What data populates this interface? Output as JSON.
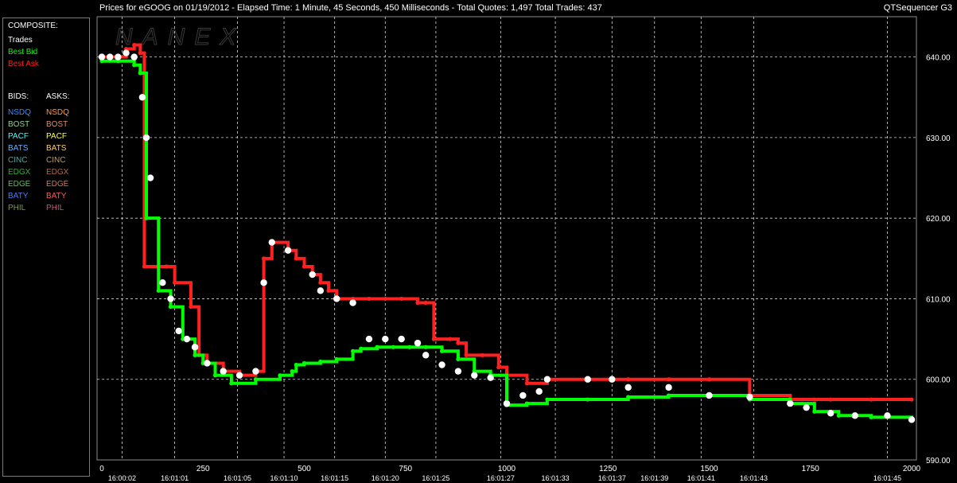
{
  "header": {
    "title": "Prices for  eGOOG  on  01/19/2012  -  Elapsed Time: 1 Minute, 45 Seconds, 450 Milliseconds  -  Total Quotes: 1,497  Total Trades: 437",
    "app": "QTSequencer G3",
    "watermark": "NANEX"
  },
  "legend": {
    "composite_label": "COMPOSITE:",
    "composite": [
      {
        "label": "Trades",
        "color": "#ffffff"
      },
      {
        "label": "Best Bid",
        "color": "#00ff00"
      },
      {
        "label": "Best Ask",
        "color": "#ff2020"
      }
    ],
    "bids_label": "BIDS:",
    "asks_label": "ASKS:",
    "exchanges": [
      {
        "bid": "NSDQ",
        "ask": "NSDQ",
        "bid_color": "#3a8cff",
        "ask_color": "#ff9a3c"
      },
      {
        "bid": "BOST",
        "ask": "BOST",
        "bid_color": "#8fd08f",
        "ask_color": "#e08a6a"
      },
      {
        "bid": "PACF",
        "ask": "PACF",
        "bid_color": "#40ffff",
        "ask_color": "#ffff40"
      },
      {
        "bid": "BATS",
        "ask": "BATS",
        "bid_color": "#6ab4ff",
        "ask_color": "#ffd070"
      },
      {
        "bid": "CINC",
        "ask": "CINC",
        "bid_color": "#4fa8a8",
        "ask_color": "#c09a6a"
      },
      {
        "bid": "EDGX",
        "ask": "EDGX",
        "bid_color": "#3aa83a",
        "ask_color": "#b06a4a"
      },
      {
        "bid": "EDGE",
        "ask": "EDGE",
        "bid_color": "#5fbf5f",
        "ask_color": "#d07a5a"
      },
      {
        "bid": "BATY",
        "ask": "BATY",
        "bid_color": "#4a7aff",
        "ask_color": "#ff5a5a"
      },
      {
        "bid": "PHIL",
        "ask": "PHIL",
        "bid_color": "#7a9a4a",
        "ask_color": "#c05a7a"
      }
    ]
  },
  "chart_data": {
    "type": "line",
    "xlim": [
      0,
      2000
    ],
    "ylim": [
      590,
      645
    ],
    "x_ticks": [
      0,
      250,
      500,
      750,
      1000,
      1250,
      1500,
      1750,
      2000
    ],
    "y_ticks": [
      590,
      600,
      610,
      620,
      630,
      640
    ],
    "time_labels": [
      {
        "x": 50,
        "label": "16:00:02"
      },
      {
        "x": 180,
        "label": "16:01:01"
      },
      {
        "x": 335,
        "label": "16:01:05"
      },
      {
        "x": 450,
        "label": "16:01:10"
      },
      {
        "x": 575,
        "label": "16:01:15"
      },
      {
        "x": 700,
        "label": "16:01:20"
      },
      {
        "x": 825,
        "label": "16:01:25"
      },
      {
        "x": 985,
        "label": "16:01:27"
      },
      {
        "x": 1120,
        "label": "16:01:33"
      },
      {
        "x": 1260,
        "label": "16:01:37"
      },
      {
        "x": 1365,
        "label": "16:01:39"
      },
      {
        "x": 1480,
        "label": "16:01:41"
      },
      {
        "x": 1610,
        "label": "16:01:43"
      },
      {
        "x": 1940,
        "label": "16:01:45"
      }
    ],
    "grid": true,
    "series": [
      {
        "name": "Best Ask",
        "color": "#ff2020",
        "points": [
          [
            0,
            640
          ],
          [
            40,
            640
          ],
          [
            60,
            641
          ],
          [
            80,
            641.5
          ],
          [
            95,
            640.5
          ],
          [
            105,
            614
          ],
          [
            160,
            614
          ],
          [
            180,
            612
          ],
          [
            220,
            609
          ],
          [
            240,
            603
          ],
          [
            260,
            602
          ],
          [
            300,
            601
          ],
          [
            340,
            600.5
          ],
          [
            380,
            601
          ],
          [
            400,
            615
          ],
          [
            420,
            617
          ],
          [
            460,
            616
          ],
          [
            480,
            615
          ],
          [
            500,
            614
          ],
          [
            520,
            613
          ],
          [
            540,
            612
          ],
          [
            560,
            611
          ],
          [
            580,
            610
          ],
          [
            620,
            610
          ],
          [
            660,
            610
          ],
          [
            700,
            610
          ],
          [
            740,
            610
          ],
          [
            780,
            609.5
          ],
          [
            800,
            609.5
          ],
          [
            820,
            605
          ],
          [
            860,
            605
          ],
          [
            880,
            604.5
          ],
          [
            900,
            603
          ],
          [
            940,
            603
          ],
          [
            980,
            601.5
          ],
          [
            1000,
            600.5
          ],
          [
            1050,
            599.5
          ],
          [
            1100,
            600
          ],
          [
            1200,
            600
          ],
          [
            1300,
            600
          ],
          [
            1400,
            600
          ],
          [
            1500,
            600
          ],
          [
            1600,
            598
          ],
          [
            1700,
            597.5
          ],
          [
            1760,
            597.5
          ],
          [
            1800,
            597.5
          ],
          [
            1900,
            597.5
          ],
          [
            2000,
            597.5
          ]
        ]
      },
      {
        "name": "Best Bid",
        "color": "#00ff00",
        "points": [
          [
            0,
            639.5
          ],
          [
            40,
            639.5
          ],
          [
            80,
            639
          ],
          [
            95,
            638
          ],
          [
            110,
            620
          ],
          [
            140,
            611
          ],
          [
            170,
            609
          ],
          [
            200,
            605
          ],
          [
            230,
            603
          ],
          [
            250,
            602
          ],
          [
            280,
            600.5
          ],
          [
            320,
            599.5
          ],
          [
            380,
            600
          ],
          [
            440,
            600.5
          ],
          [
            470,
            601
          ],
          [
            480,
            601.8
          ],
          [
            500,
            602
          ],
          [
            540,
            602.2
          ],
          [
            580,
            602.5
          ],
          [
            620,
            603.5
          ],
          [
            640,
            603.8
          ],
          [
            680,
            604
          ],
          [
            720,
            604
          ],
          [
            760,
            604
          ],
          [
            800,
            604
          ],
          [
            840,
            603.5
          ],
          [
            880,
            602.5
          ],
          [
            920,
            601
          ],
          [
            960,
            600.5
          ],
          [
            1000,
            596.8
          ],
          [
            1050,
            597
          ],
          [
            1100,
            597.5
          ],
          [
            1200,
            597.5
          ],
          [
            1300,
            597.8
          ],
          [
            1400,
            598
          ],
          [
            1500,
            598
          ],
          [
            1600,
            597.5
          ],
          [
            1700,
            597
          ],
          [
            1760,
            596
          ],
          [
            1820,
            595.5
          ],
          [
            1900,
            595.3
          ],
          [
            2000,
            595.2
          ]
        ]
      },
      {
        "name": "Trades",
        "color": "#ffffff",
        "points": [
          [
            0,
            640
          ],
          [
            20,
            640
          ],
          [
            40,
            640
          ],
          [
            60,
            640.5
          ],
          [
            80,
            640
          ],
          [
            100,
            635
          ],
          [
            110,
            630
          ],
          [
            120,
            625
          ],
          [
            150,
            612
          ],
          [
            170,
            610
          ],
          [
            190,
            606
          ],
          [
            210,
            605
          ],
          [
            230,
            604
          ],
          [
            260,
            602
          ],
          [
            300,
            601
          ],
          [
            340,
            600.5
          ],
          [
            380,
            601
          ],
          [
            400,
            612
          ],
          [
            420,
            617
          ],
          [
            460,
            616
          ],
          [
            520,
            613
          ],
          [
            540,
            611
          ],
          [
            580,
            610
          ],
          [
            620,
            609.5
          ],
          [
            660,
            605
          ],
          [
            700,
            605
          ],
          [
            740,
            605
          ],
          [
            780,
            604.5
          ],
          [
            800,
            603
          ],
          [
            840,
            601.8
          ],
          [
            880,
            601
          ],
          [
            920,
            600.5
          ],
          [
            960,
            600.2
          ],
          [
            1000,
            597
          ],
          [
            1040,
            598
          ],
          [
            1080,
            598.5
          ],
          [
            1100,
            600
          ],
          [
            1200,
            600
          ],
          [
            1260,
            600
          ],
          [
            1300,
            599
          ],
          [
            1400,
            599
          ],
          [
            1500,
            598
          ],
          [
            1600,
            597.8
          ],
          [
            1700,
            597
          ],
          [
            1740,
            596.5
          ],
          [
            1800,
            595.8
          ],
          [
            1860,
            595.5
          ],
          [
            1940,
            595.5
          ],
          [
            2000,
            595
          ]
        ]
      }
    ]
  }
}
